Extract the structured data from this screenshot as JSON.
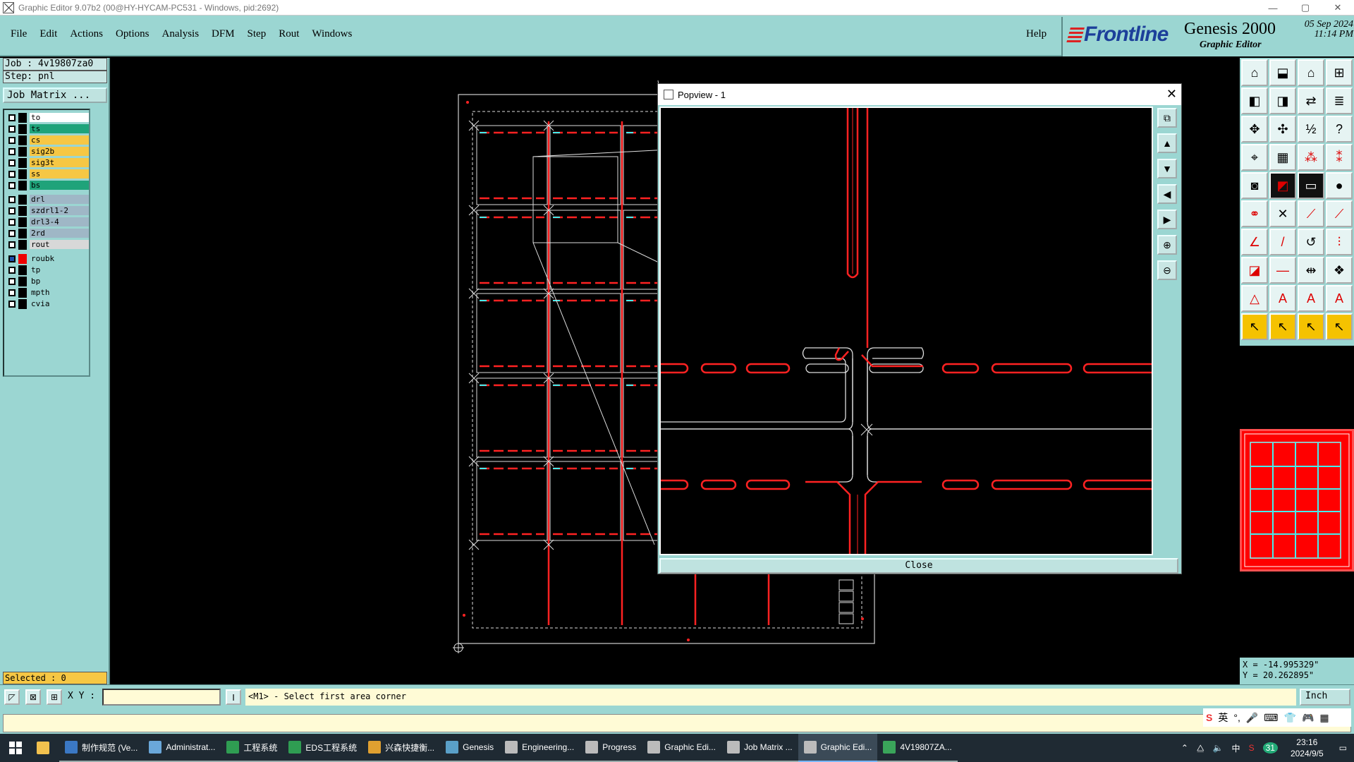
{
  "window": {
    "title": "Graphic Editor 9.07b2 (00@HY-HYCAM-PC531 - Windows, pid:2692)",
    "minimize": "—",
    "maximize": "▢",
    "close": "✕"
  },
  "menu": {
    "items": [
      "File",
      "Edit",
      "Actions",
      "Options",
      "Analysis",
      "DFM",
      "Step",
      "Rout",
      "Windows"
    ],
    "help": "Help"
  },
  "brand": {
    "logo": "Frontline",
    "product": "Genesis 2000",
    "subtitle": "Graphic Editor",
    "date": "05 Sep 2024",
    "time": "11:14 PM"
  },
  "job": {
    "job_label": "Job  : 4v19807za0",
    "step_label": "Step: pnl",
    "matrix_button": "Job Matrix ..."
  },
  "layers": [
    {
      "name": "to",
      "color": "#ffffff"
    },
    {
      "name": "ts",
      "color": "#1fa37a"
    },
    {
      "name": "cs",
      "color": "#f6c744"
    },
    {
      "name": "sig2b",
      "color": "#f6c744"
    },
    {
      "name": "sig3t",
      "color": "#f6c744"
    },
    {
      "name": "ss",
      "color": "#f6c744"
    },
    {
      "name": "bs",
      "color": "#1fa37a"
    },
    {
      "name": "drl",
      "color": "#9fb7c6"
    },
    {
      "name": "szdrl1-2",
      "color": "#9fb7c6"
    },
    {
      "name": "drl3-4",
      "color": "#9fb7c6"
    },
    {
      "name": "2rd",
      "color": "#9fb7c6"
    },
    {
      "name": "rout",
      "color": "#d8d8d8"
    },
    {
      "name": "roubk",
      "color": "#9bd6d2",
      "active": true
    },
    {
      "name": "tp",
      "color": "#9bd6d2"
    },
    {
      "name": "bp",
      "color": "#9bd6d2"
    },
    {
      "name": "mpth",
      "color": "#9bd6d2"
    },
    {
      "name": "cvia",
      "color": "#9bd6d2"
    }
  ],
  "selected": "Selected : 0",
  "popview": {
    "title": "Popview - 1",
    "close_button": "Close"
  },
  "coords": {
    "x": "X = -14.995329\"",
    "y": "Y =  20.262895\""
  },
  "command": {
    "xy_label": "X Y :",
    "xy_value": "",
    "prompt": "<M1> - Select first area corner",
    "units": "Inch"
  },
  "taskbar": {
    "items": [
      {
        "label": "制作规范 (Ve...",
        "state": "open"
      },
      {
        "label": "Administrat...",
        "state": "open"
      },
      {
        "label": "工程系统",
        "state": "open"
      },
      {
        "label": "EDS工程系统",
        "state": "open"
      },
      {
        "label": "兴森快捷衡...",
        "state": "open"
      },
      {
        "label": "Genesis",
        "state": "open"
      },
      {
        "label": "Engineering...",
        "state": "open"
      },
      {
        "label": "Progress",
        "state": "open"
      },
      {
        "label": "Graphic Edi...",
        "state": "open"
      },
      {
        "label": "Job Matrix ...",
        "state": "open"
      },
      {
        "label": "Graphic Edi...",
        "state": "active"
      },
      {
        "label": "4V19807ZA...",
        "state": "open"
      }
    ],
    "clock_time": "23:16",
    "clock_date": "2024/9/5",
    "ime_lang": "英",
    "tray_lang": "中",
    "badge": "31"
  }
}
